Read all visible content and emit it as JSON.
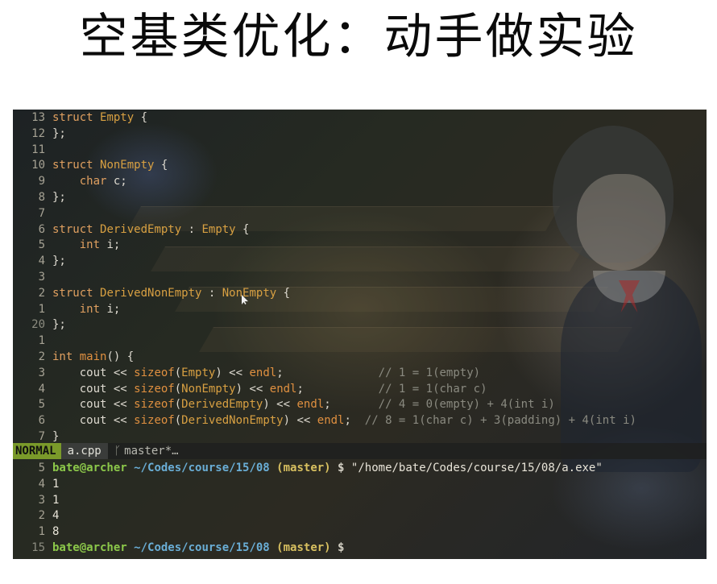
{
  "slide": {
    "title": "空基类优化：动手做实验"
  },
  "editor": {
    "lines": [
      {
        "ln": "13",
        "tokens": [
          [
            "kw",
            "struct "
          ],
          [
            "ty",
            "Empty"
          ],
          [
            "pl",
            " {"
          ]
        ]
      },
      {
        "ln": "12",
        "tokens": [
          [
            "pl",
            "};"
          ]
        ]
      },
      {
        "ln": "11",
        "tokens": []
      },
      {
        "ln": "10",
        "tokens": [
          [
            "kw",
            "struct "
          ],
          [
            "ty",
            "NonEmpty"
          ],
          [
            "pl",
            " {"
          ]
        ]
      },
      {
        "ln": "9",
        "tokens": [
          [
            "pl",
            "    "
          ],
          [
            "kw",
            "char"
          ],
          [
            "pl",
            " c;"
          ]
        ]
      },
      {
        "ln": "8",
        "tokens": [
          [
            "pl",
            "};"
          ]
        ]
      },
      {
        "ln": "7",
        "tokens": []
      },
      {
        "ln": "6",
        "tokens": [
          [
            "kw",
            "struct "
          ],
          [
            "ty",
            "DerivedEmpty"
          ],
          [
            "pl",
            " : "
          ],
          [
            "ty",
            "Empty"
          ],
          [
            "pl",
            " {"
          ]
        ]
      },
      {
        "ln": "5",
        "tokens": [
          [
            "pl",
            "    "
          ],
          [
            "kw",
            "int"
          ],
          [
            "pl",
            " i;"
          ]
        ]
      },
      {
        "ln": "4",
        "tokens": [
          [
            "pl",
            "};"
          ]
        ]
      },
      {
        "ln": "3",
        "tokens": []
      },
      {
        "ln": "2",
        "tokens": [
          [
            "kw",
            "struct "
          ],
          [
            "ty",
            "DerivedNonEmpty"
          ],
          [
            "pl",
            " : "
          ],
          [
            "ty",
            "NonEmpty"
          ],
          [
            "pl",
            " {"
          ]
        ]
      },
      {
        "ln": "1",
        "tokens": [
          [
            "pl",
            "    "
          ],
          [
            "kw",
            "int"
          ],
          [
            "pl",
            " i;"
          ]
        ]
      },
      {
        "ln": "20",
        "cur": true,
        "tokens": [
          [
            "pl",
            "};"
          ]
        ]
      },
      {
        "ln": "1",
        "tokens": []
      },
      {
        "ln": "2",
        "tokens": [
          [
            "kw",
            "int "
          ],
          [
            "fn",
            "main"
          ],
          [
            "pl",
            "() {"
          ]
        ]
      },
      {
        "ln": "3",
        "tokens": [
          [
            "pl",
            "    cout << "
          ],
          [
            "fn",
            "sizeof"
          ],
          [
            "pl",
            "("
          ],
          [
            "ty",
            "Empty"
          ],
          [
            "pl",
            ") << "
          ],
          [
            "fn",
            "endl"
          ],
          [
            "pl",
            ";              "
          ],
          [
            "cm",
            "// 1 = 1(empty)"
          ]
        ]
      },
      {
        "ln": "4",
        "tokens": [
          [
            "pl",
            "    cout << "
          ],
          [
            "fn",
            "sizeof"
          ],
          [
            "pl",
            "("
          ],
          [
            "ty",
            "NonEmpty"
          ],
          [
            "pl",
            ") << "
          ],
          [
            "fn",
            "endl"
          ],
          [
            "pl",
            ";           "
          ],
          [
            "cm",
            "// 1 = 1(char c)"
          ]
        ]
      },
      {
        "ln": "5",
        "tokens": [
          [
            "pl",
            "    cout << "
          ],
          [
            "fn",
            "sizeof"
          ],
          [
            "pl",
            "("
          ],
          [
            "ty",
            "DerivedEmpty"
          ],
          [
            "pl",
            ") << "
          ],
          [
            "fn",
            "endl"
          ],
          [
            "pl",
            ";       "
          ],
          [
            "cm",
            "// 4 = 0(empty) + 4(int i)"
          ]
        ]
      },
      {
        "ln": "6",
        "tokens": [
          [
            "pl",
            "    cout << "
          ],
          [
            "fn",
            "sizeof"
          ],
          [
            "pl",
            "("
          ],
          [
            "ty",
            "DerivedNonEmpty"
          ],
          [
            "pl",
            ") << "
          ],
          [
            "fn",
            "endl"
          ],
          [
            "pl",
            ";  "
          ],
          [
            "cm",
            "// 8 = 1(char c) + 3(padding) + 4(int i)"
          ]
        ]
      },
      {
        "ln": "7",
        "tokens": [
          [
            "pl",
            "}"
          ]
        ]
      }
    ]
  },
  "statusline": {
    "mode": "NORMAL",
    "file": "a.cpp",
    "branch_icon": "branch-icon",
    "branch": "master*…"
  },
  "terminal": {
    "lines": [
      {
        "ln": "5",
        "type": "prompt",
        "user": "bate@archer",
        "path": "~/Codes/course/15/08",
        "branch": "(master)",
        "dollar": "$",
        "cmd": "\"/home/bate/Codes/course/15/08/a.exe\""
      },
      {
        "ln": "4",
        "type": "out",
        "text": "1"
      },
      {
        "ln": "3",
        "type": "out",
        "text": "1"
      },
      {
        "ln": "2",
        "type": "out",
        "text": "4"
      },
      {
        "ln": "1",
        "type": "out",
        "text": "8"
      },
      {
        "ln": "15",
        "cur": true,
        "type": "prompt",
        "user": "bate@archer",
        "path": "~/Codes/course/15/08",
        "branch": "(master)",
        "dollar": "$",
        "cmd": ""
      }
    ]
  }
}
